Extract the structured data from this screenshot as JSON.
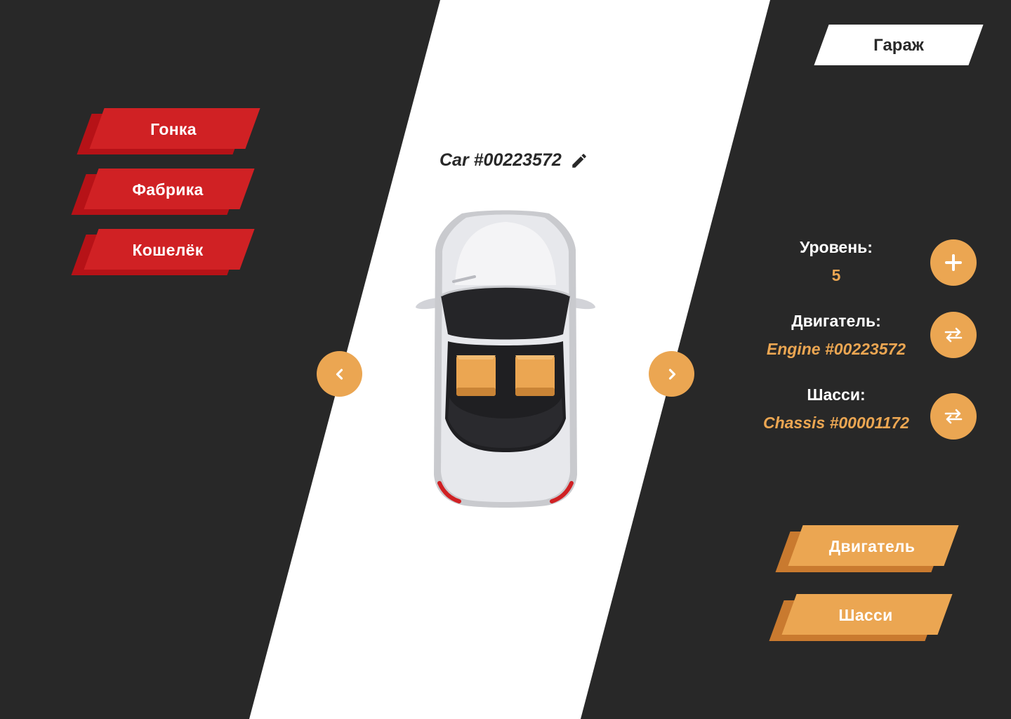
{
  "colors": {
    "background_dark": "#282828",
    "stripe": "#ffffff",
    "accent_red": "#d02124",
    "accent_orange": "#eba652"
  },
  "header": {
    "garage_tab_label": "Гараж"
  },
  "menu": {
    "items": [
      {
        "label": "Гонка"
      },
      {
        "label": "Фабрика"
      },
      {
        "label": "Кошелёк"
      }
    ]
  },
  "car": {
    "title": "Car #00223572",
    "edit_icon": "pencil-icon",
    "prev_icon": "chevron-left-icon",
    "next_icon": "chevron-right-icon"
  },
  "stats": {
    "level_label": "Уровень:",
    "level_value": "5",
    "level_action_icon": "plus-icon",
    "engine_label": "Двигатель:",
    "engine_value": "Engine #00223572",
    "engine_action_icon": "swap-icon",
    "chassis_label": "Шасси:",
    "chassis_value": "Chassis #00001172",
    "chassis_action_icon": "swap-icon"
  },
  "actions": {
    "engine_button": "Двигатель",
    "chassis_button": "Шасси"
  }
}
